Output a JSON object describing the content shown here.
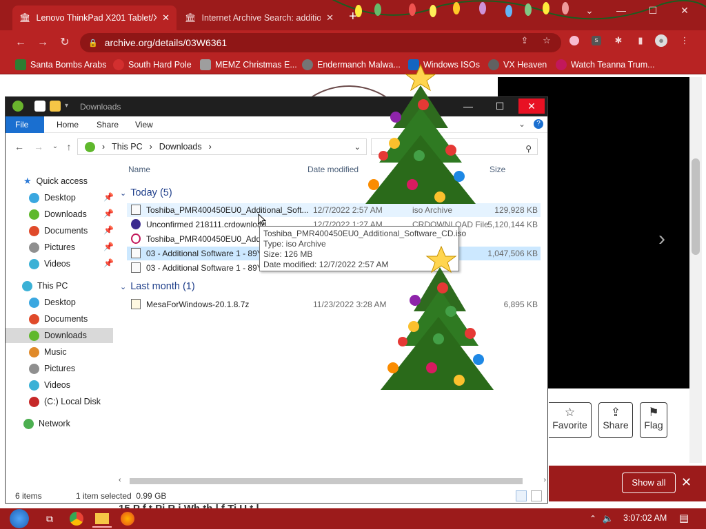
{
  "browser": {
    "tabs": [
      {
        "title": "Lenovo ThinkPad X201 Tablet/X2",
        "active": true
      },
      {
        "title": "Internet Archive Search: additio",
        "active": false
      }
    ],
    "url": "archive.org/details/03W6361",
    "bookmarks": [
      {
        "label": "Santa Bombs Arabs",
        "color": "#2e7d32"
      },
      {
        "label": "South Hard Pole",
        "color": "#d32f2f"
      },
      {
        "label": "MEMZ Christmas E...",
        "color": "#9e9e9e"
      },
      {
        "label": "Endermanch Malwa...",
        "color": "#757575"
      },
      {
        "label": "Windows ISOs",
        "color": "#1565c0"
      },
      {
        "label": "VX Heaven",
        "color": "#616161"
      },
      {
        "label": "Watch Teanna Trum...",
        "color": "#c2185b"
      }
    ],
    "page_buttons": [
      {
        "label": "Favorite",
        "icon": "star-icon"
      },
      {
        "label": "Share",
        "icon": "share-icon"
      },
      {
        "label": "Flag",
        "icon": "flag-icon"
      }
    ],
    "banner_button": "Show all",
    "behind_text": "15 P f  t Pi   R  i              Wh  th  l        f                Ti    U      t  l"
  },
  "explorer": {
    "title": "Downloads",
    "ribbon_tabs": [
      "File",
      "Home",
      "Share",
      "View"
    ],
    "path": [
      "This PC",
      "Downloads"
    ],
    "search_placeholder": "ads",
    "columns": {
      "name": "Name",
      "date": "Date modified",
      "size": "Size"
    },
    "nav": [
      {
        "label": "Quick access",
        "level": 0,
        "icon_color": "#2b79d6",
        "pinned": false
      },
      {
        "label": "Desktop",
        "level": 1,
        "icon_color": "#3aa7e0",
        "pinned": true
      },
      {
        "label": "Downloads",
        "level": 1,
        "icon_color": "#5fb82c",
        "pinned": true
      },
      {
        "label": "Documents",
        "level": 1,
        "icon_color": "#e04a2a",
        "pinned": true
      },
      {
        "label": "Pictures",
        "level": 1,
        "icon_color": "#8f8f8f",
        "pinned": true
      },
      {
        "label": "Videos",
        "level": 1,
        "icon_color": "#3bb1d6",
        "pinned": true
      },
      {
        "label": "This PC",
        "level": 0,
        "icon_color": "#3bb1d6",
        "pinned": false
      },
      {
        "label": "Desktop",
        "level": 1,
        "icon_color": "#3aa7e0",
        "pinned": false
      },
      {
        "label": "Documents",
        "level": 1,
        "icon_color": "#e04a2a",
        "pinned": false
      },
      {
        "label": "Downloads",
        "level": 1,
        "icon_color": "#5fb82c",
        "pinned": false,
        "selected": true
      },
      {
        "label": "Music",
        "level": 1,
        "icon_color": "#e08a2a",
        "pinned": false
      },
      {
        "label": "Pictures",
        "level": 1,
        "icon_color": "#8f8f8f",
        "pinned": false
      },
      {
        "label": "Videos",
        "level": 1,
        "icon_color": "#3bb1d6",
        "pinned": false
      },
      {
        "label": "(C:) Local Disk",
        "level": 1,
        "icon_color": "#c62828",
        "pinned": false
      },
      {
        "label": "Network",
        "level": 0,
        "icon_color": "#4caf50",
        "pinned": false
      }
    ],
    "groups": [
      {
        "label": "Today (5)",
        "files": [
          {
            "name": "Toshiba_PMR400450EU0_Additional_Soft...",
            "date": "12/7/2022 2:57 AM",
            "type": "iso Archive",
            "size": "129,928 KB",
            "state": "hover"
          },
          {
            "name": "Unconfirmed 218111.crdownload",
            "date": "12/7/2022 1:27 AM",
            "type": "CRDOWNLOAD File",
            "size": "5,120,144 KB",
            "state": ""
          },
          {
            "name": "Toshiba_PMR400450EU0_Additio",
            "date": "",
            "type": "",
            "size": "",
            "state": ""
          },
          {
            "name": "03 - Additional Software 1 - 89Y6",
            "date": "",
            "type": "",
            "size": "1,047,506 KB",
            "state": "selected"
          },
          {
            "name": "03 - Additional Software 1 - 89Y6",
            "date": "",
            "type": "",
            "size": "",
            "state": ""
          }
        ]
      },
      {
        "label": "Last month (1)",
        "files": [
          {
            "name": "MesaForWindows-20.1.8.7z",
            "date": "11/23/2022 3:28 AM",
            "type": "",
            "size": "6,895 KB",
            "state": ""
          }
        ]
      }
    ],
    "tooltip": [
      "Toshiba_PMR400450EU0_Additional_Software_CD.iso",
      "Type: iso Archive",
      "Size: 126 MB",
      "Date modified: 12/7/2022 2:57 AM"
    ],
    "status": {
      "items": "6 items",
      "selected": "1 item selected  0.99 GB"
    }
  },
  "taskbar": {
    "clock": "3:07:02 AM"
  }
}
